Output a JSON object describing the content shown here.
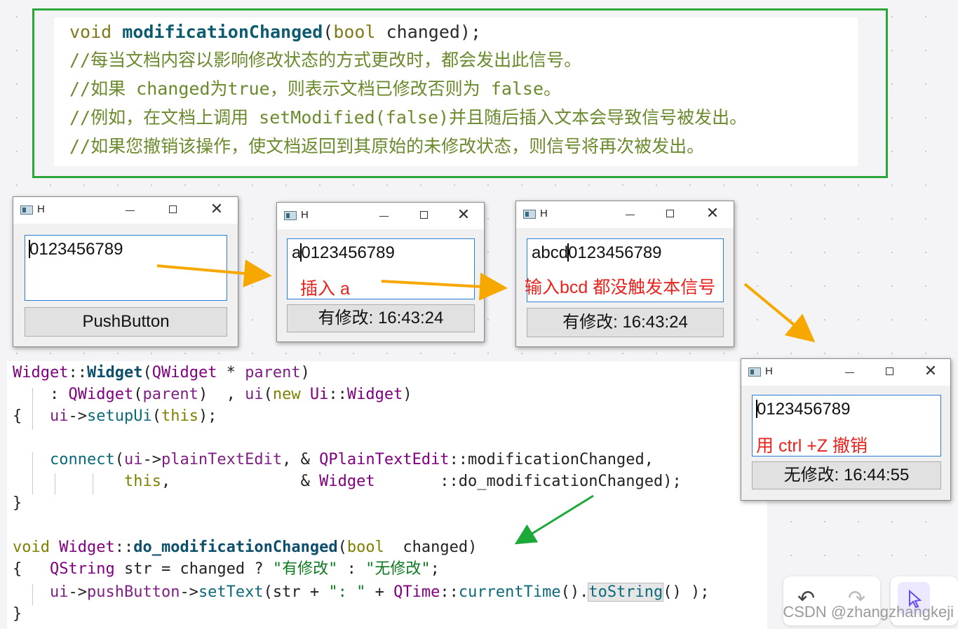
{
  "doc": {
    "line1": {
      "void": "void",
      "fn": "modificationChanged",
      "open": "(",
      "bool": "bool",
      "rest": "  changed);"
    },
    "line2": "//每当文档内容以影响修改状态的方式更改时，都会发出此信号。",
    "line3": "//如果 changed为true，则表示文档已修改否则为 false。",
    "line4": "//例如，在文档上调用 setModified(false)并且随后插入文本会导致信号被发出。",
    "line5": "//如果您撤销该操作，使文档返回到其原始的未修改状态，则信号将再次被发出。"
  },
  "windows": [
    {
      "title": "H",
      "text_before": "",
      "text_after": "0123456789",
      "note": "",
      "button": "PushButton"
    },
    {
      "title": "H",
      "text_before": "a",
      "text_after": "0123456789",
      "note": "插入 a",
      "button": "有修改: 16:43:24"
    },
    {
      "title": "H",
      "text_before": "abcd",
      "text_after": "0123456789",
      "note": "输入bcd 都没触发本信号",
      "button": "有修改: 16:43:24"
    },
    {
      "title": "H",
      "text_before": "",
      "text_after": "0123456789",
      "note": "用 ctrl +Z 撤销",
      "button": "无修改: 16:44:55"
    }
  ],
  "titlebar": {
    "min": "—",
    "max": "☐",
    "close": "✕"
  },
  "code": {
    "l1": {
      "a": "Widget",
      "b": "::",
      "c": "Widget",
      "d": "(",
      "e": "QWidget",
      "f": " * ",
      "g": "parent",
      "h": ")"
    },
    "l2": {
      "a": "    : ",
      "b": "QWidget",
      "c": "(",
      "d": "parent",
      "e": ")  , ",
      "f": "ui",
      "g": "(",
      "h": "new",
      "i": " ",
      "j": "Ui",
      "k": "::",
      "l": "Widget",
      "m": ")"
    },
    "l3": {
      "a": "{   ",
      "b": "ui",
      "c": "->",
      "d": "setupUi",
      "e": "(",
      "f": "this",
      "g": ");"
    },
    "l4": {
      "a": "    ",
      "b": "connect",
      "c": "(",
      "d": "ui",
      "e": "->",
      "f": "plainTextEdit",
      "g": ", & ",
      "h": "QPlainTextEdit",
      "i": "::modificationChanged,",
      "j": ""
    },
    "l5": {
      "a": "            ",
      "b": "this",
      "c": ",              & ",
      "d": "Widget",
      "e": "       ::do_modificationChanged);"
    },
    "l6": "}",
    "l7": {
      "a": "void",
      "b": " ",
      "c": "Widget",
      "d": "::",
      "e": "do_modificationChanged",
      "f": "(",
      "g": "bool",
      "h": "  ",
      "i": "changed",
      "j": ")"
    },
    "l8": {
      "a": "{   ",
      "b": "QString",
      "c": " ",
      "d": "str",
      "e": " = ",
      "f": "changed",
      "g": " ? ",
      "h": "\"有修改\"",
      "i": " : ",
      "j": "\"无修改\"",
      "k": ";"
    },
    "l9": {
      "a": "    ",
      "b": "ui",
      "c": "->",
      "d": "pushButton",
      "e": "->",
      "f": "setText",
      "g": "(",
      "h": "str",
      "i": " + ",
      "j": "\": \"",
      "k": " + ",
      "l": "QTime",
      "m": "::",
      "n": "currentTime",
      "o": "().",
      "p": "toString",
      "q": "() );"
    },
    "l10": "}"
  },
  "toolbar": {
    "undo": "↶",
    "redo": "↷"
  },
  "watermark": "CSDN @zhangzhangkeji",
  "colors": {
    "frame_green": "#2aa63a",
    "arrow_orange": "#f7a800",
    "arrow_green": "#1da83a",
    "note_red": "#e8231e",
    "focus_blue": "#2a7fd6"
  }
}
